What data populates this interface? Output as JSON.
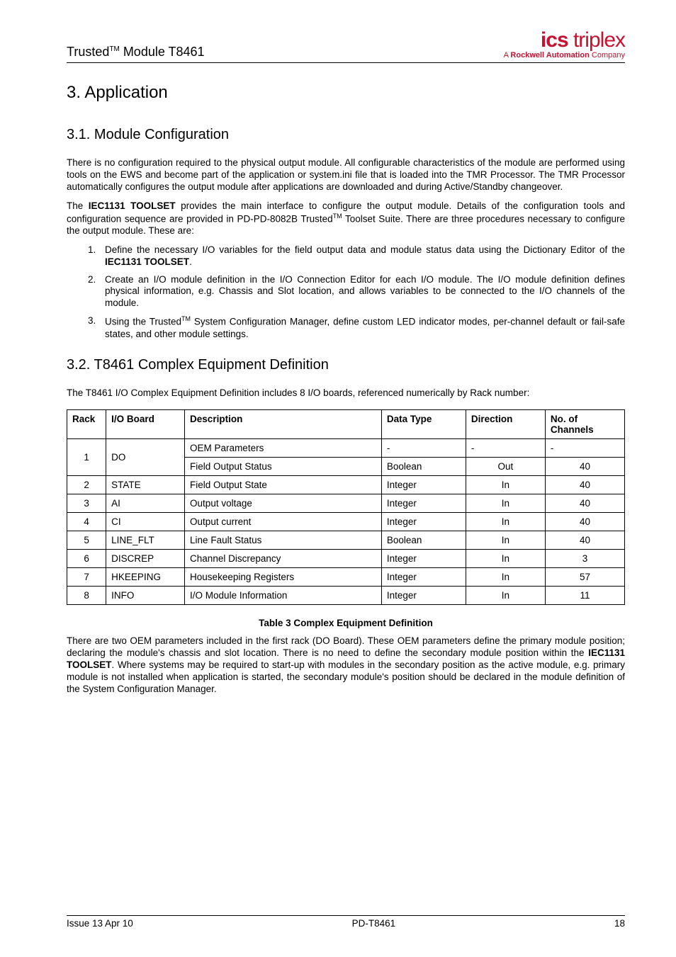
{
  "header": {
    "title_prefix": "Trusted",
    "title_suffix": " Module T8461",
    "logo_ics": "ics",
    "logo_triplex": " triplex",
    "logo_sub_a": "A ",
    "logo_sub_rockwell": "Rockwell Automation",
    "logo_sub_company": " Company"
  },
  "section3": {
    "heading": "3.   Application"
  },
  "section3_1": {
    "heading": "3.1. Module Configuration",
    "p1": "There is no configuration required to the physical output module.  All configurable characteristics of the module are performed using tools on the EWS and become part of the application or system.ini file that is loaded into the TMR Processor.  The TMR Processor automatically configures the output module after applications are downloaded and during Active/Standby changeover.",
    "p2_a": "The ",
    "p2_bold": "IEC1131 TOOLSET",
    "p2_b": " provides the main interface to configure the output module.  Details of the configuration tools and configuration sequence are provided in PD-PD-8082B Trusted",
    "p2_c": " Toolset Suite.  There are three procedures necessary to configure the output module.  These are:",
    "li1_a": "Define the necessary I/O variables for the field output data and module status data using the Dictionary Editor of the ",
    "li1_bold": "IEC1131 TOOLSET",
    "li1_b": ".",
    "li2": "Create an I/O module definition in the I/O Connection Editor for each I/O module.  The I/O module definition defines physical information, e.g. Chassis and Slot location, and allows variables to be connected to the I/O channels of the module.",
    "li3_a": "Using the Trusted",
    "li3_b": " System Configuration Manager, define custom LED indicator modes, per-channel default or fail-safe states, and other module settings."
  },
  "section3_2": {
    "heading": "3.2. T8461 Complex Equipment Definition",
    "p1": "The T8461 I/O Complex Equipment Definition includes 8 I/O boards, referenced numerically by Rack number:",
    "p2_a": "There are two OEM parameters included in the first rack (DO Board).  These OEM parameters define the primary module position; declaring the module's chassis and slot location.  There is no need to define the secondary module position within the ",
    "p2_bold": "IEC1131 TOOLSET",
    "p2_b": ".  Where systems may be required to start-up with modules in the secondary position as the active module, e.g. primary module is not installed when application is started, the secondary module's position should be declared in the module definition of the System Configuration Manager."
  },
  "table": {
    "headers": {
      "rack": "Rack",
      "ioboard": "I/O Board",
      "description": "Description",
      "datatype": "Data Type",
      "direction": "Direction",
      "channels": "No. of Channels"
    },
    "rows": [
      {
        "rack": "1",
        "io": "DO",
        "desc": "OEM Parameters",
        "dt": "-",
        "dir": "-",
        "ch": "-"
      },
      {
        "desc": "Field Output Status",
        "dt": "Boolean",
        "dir": "Out",
        "ch": "40"
      },
      {
        "rack": "2",
        "io": "STATE",
        "desc": "Field Output State",
        "dt": "Integer",
        "dir": "In",
        "ch": "40"
      },
      {
        "rack": "3",
        "io": "AI",
        "desc": "Output voltage",
        "dt": "Integer",
        "dir": "In",
        "ch": "40"
      },
      {
        "rack": "4",
        "io": "CI",
        "desc": "Output current",
        "dt": "Integer",
        "dir": "In",
        "ch": "40"
      },
      {
        "rack": "5",
        "io": "LINE_FLT",
        "desc": "Line Fault Status",
        "dt": "Boolean",
        "dir": "In",
        "ch": "40"
      },
      {
        "rack": "6",
        "io": "DISCREP",
        "desc": "Channel Discrepancy",
        "dt": "Integer",
        "dir": "In",
        "ch": "3"
      },
      {
        "rack": "7",
        "io": "HKEEPING",
        "desc": "Housekeeping Registers",
        "dt": "Integer",
        "dir": "In",
        "ch": "57"
      },
      {
        "rack": "8",
        "io": "INFO",
        "desc": "I/O Module Information",
        "dt": "Integer",
        "dir": "In",
        "ch": "11"
      }
    ],
    "caption": "Table 3 Complex Equipment Definition"
  },
  "footer": {
    "left": "Issue 13 Apr 10",
    "center": "PD-T8461",
    "right": "18"
  }
}
